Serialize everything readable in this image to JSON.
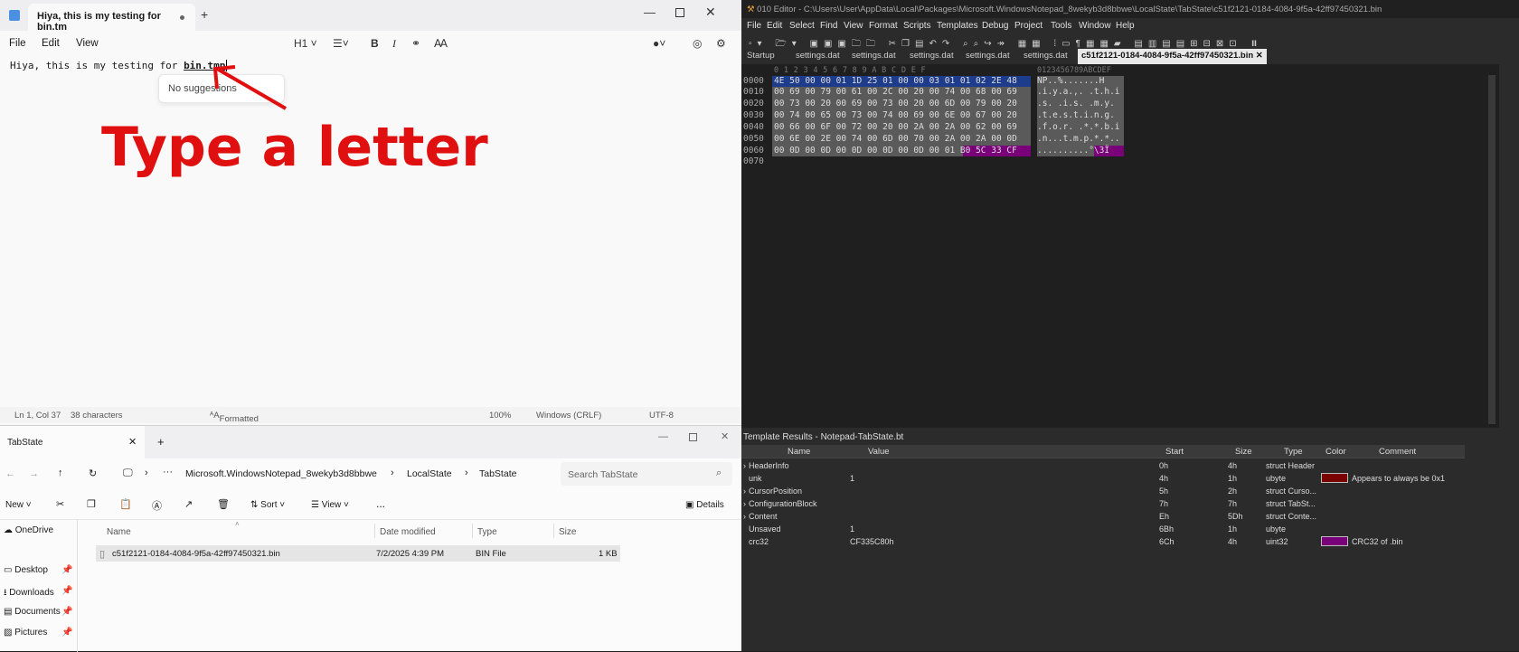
{
  "notepad": {
    "tab_title": "Hiya, this is my testing for bin.tm",
    "menu": [
      "File",
      "Edit",
      "View"
    ],
    "heading_label": "H1",
    "text_prefix": "Hiya, this is my testing for ",
    "text_underlined": "bin.tmp",
    "suggestion": "No suggestions",
    "overlay": "Type a letter",
    "status": {
      "position": "Ln 1, Col 37",
      "chars": "38 characters",
      "format": "Formatted",
      "zoom": "100%",
      "eol": "Windows (CRLF)",
      "encoding": "UTF-8"
    }
  },
  "explorer": {
    "tab_title": "TabState",
    "breadcrumb": [
      "Microsoft.WindowsNotepad_8wekyb3d8bbwe",
      "LocalState",
      "TabState"
    ],
    "search_placeholder": "Search TabState",
    "toolbar": {
      "new": "New",
      "sort": "Sort",
      "view": "View",
      "details": "Details",
      "more": "..."
    },
    "columns": [
      "Name",
      "Date modified",
      "Type",
      "Size"
    ],
    "file": {
      "name": "c51f2121-0184-4084-9f5a-42ff97450321.bin",
      "date": "7/2/2025 4:39 PM",
      "type": "BIN File",
      "size": "1 KB"
    },
    "nav": [
      "OneDrive",
      "Desktop",
      "Downloads",
      "Documents",
      "Pictures"
    ]
  },
  "editor": {
    "title": "010 Editor - C:\\Users\\User\\AppData\\Local\\Packages\\Microsoft.WindowsNotepad_8wekyb3d8bbwe\\LocalState\\TabState\\c51f2121-0184-4084-9f5a-42ff97450321.bin",
    "menu": [
      "File",
      "Edit",
      "Select",
      "Find",
      "View",
      "Format",
      "Scripts",
      "Templates",
      "Debug",
      "Project",
      "Tools",
      "Window",
      "Help"
    ],
    "tabs": [
      "Startup",
      "settings.dat",
      "settings.dat",
      "settings.dat",
      "settings.dat",
      "settings.dat",
      "c51f2121-0184-4084-9f5a-42ff97450321.bin"
    ],
    "col_header": "0  1  2  3  4  5  6  7  8  9  A  B  C  D  E  F",
    "ascii_header": "0123456789ABCDEF",
    "offsets": [
      "0000",
      "0010",
      "0020",
      "0030",
      "0040",
      "0050",
      "0060",
      "0070"
    ],
    "hex_rows": [
      "4E 50 00 00 01 1D 25 01 00 00 03 01 01 02 2E 48",
      "00 69 00 79 00 61 00 2C 00 20 00 74 00 68 00 69",
      "00 73 00 20 00 69 00 73 00 20 00 6D 00 79 00 20",
      "00 74 00 65 00 73 00 74 00 69 00 6E 00 67 00 20",
      "00 66 00 6F 00 72 00 20 00 2A 00 2A 00 62 00 69",
      "00 6E 00 2E 00 74 00 6D 00 70 00 2A 00 2A 00 0D",
      "00 0D 00 0D 00 0D 00 0D 00 0D 00 01 B0 5C 33 CF",
      ""
    ],
    "ascii_rows": [
      "NP..%.......H",
      ".i.y.a.,. .t.h.i",
      ".s. .i.s. .m.y. ",
      ".t.e.s.t.i.n.g. ",
      ".f.o.r. .*.*.b.i",
      ".n...t.m.p.*.*..",
      "..........°\\3Ï",
      ""
    ],
    "template_title": "Template Results - Notepad-TabState.bt",
    "template_columns": [
      "Name",
      "Value",
      "Start",
      "Size",
      "Type",
      "Color",
      "Comment"
    ],
    "template_rows": [
      {
        "name": "HeaderInfo",
        "value": "",
        "start": "0h",
        "size": "4h",
        "type": "struct Header",
        "color": "",
        "comment": "",
        "expand": true
      },
      {
        "name": "unk",
        "value": "1",
        "start": "4h",
        "size": "1h",
        "type": "ubyte",
        "color": "#7a0000",
        "comment": "Appears to always be 0x1",
        "expand": false
      },
      {
        "name": "CursorPosition",
        "value": "",
        "start": "5h",
        "size": "2h",
        "type": "struct Curso...",
        "color": "",
        "comment": "",
        "expand": true
      },
      {
        "name": "ConfigurationBlock",
        "value": "",
        "start": "7h",
        "size": "7h",
        "type": "struct TabSt...",
        "color": "",
        "comment": "",
        "expand": true
      },
      {
        "name": "Content",
        "value": "",
        "start": "Eh",
        "size": "5Dh",
        "type": "struct Conte...",
        "color": "",
        "comment": "",
        "expand": true
      },
      {
        "name": "Unsaved",
        "value": "1",
        "start": "6Bh",
        "size": "1h",
        "type": "ubyte",
        "color": "",
        "comment": "",
        "expand": false
      },
      {
        "name": "crc32",
        "value": "CF335C80h",
        "start": "6Ch",
        "size": "4h",
        "type": "uint32",
        "color": "#7a007a",
        "comment": "CRC32 of .bin",
        "expand": false
      }
    ]
  }
}
